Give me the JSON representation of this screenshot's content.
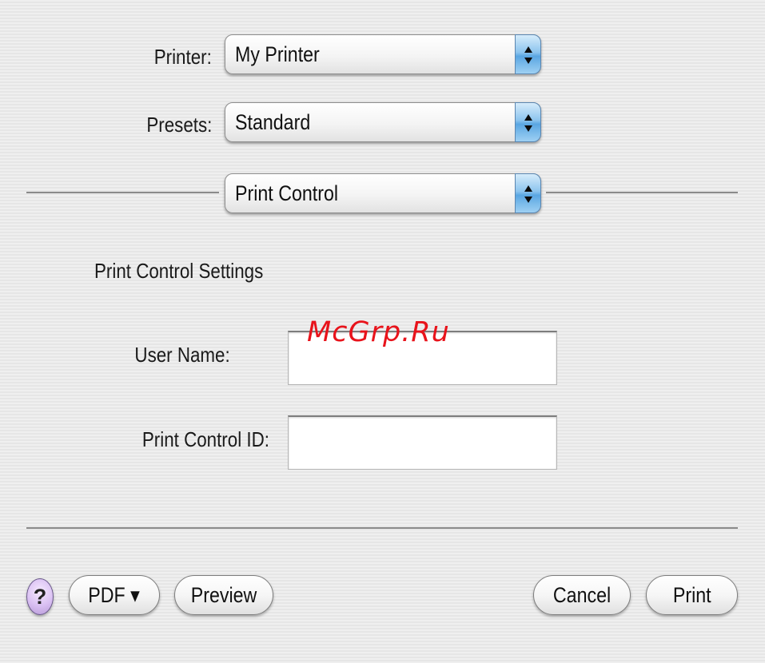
{
  "printer": {
    "label": "Printer:",
    "value": "My Printer"
  },
  "presets": {
    "label": "Presets:",
    "value": "Standard"
  },
  "panel_menu": {
    "value": "Print Control"
  },
  "section": {
    "title": "Print Control Settings",
    "user_name": {
      "label": "User Name:",
      "value": ""
    },
    "print_control_id": {
      "label": "Print Control ID:",
      "value": ""
    }
  },
  "buttons": {
    "help": "?",
    "pdf": "PDF ▾",
    "preview": "Preview",
    "cancel": "Cancel",
    "print": "Print"
  },
  "watermark": "McGrp.Ru",
  "colors": {
    "accent": "#5aa6e2",
    "help": "#d9bff2",
    "watermark": "#e8131b"
  },
  "icons": {
    "popup_arrows": "up-down-arrows-icon",
    "pdf_dropdown": "triangle-down"
  }
}
